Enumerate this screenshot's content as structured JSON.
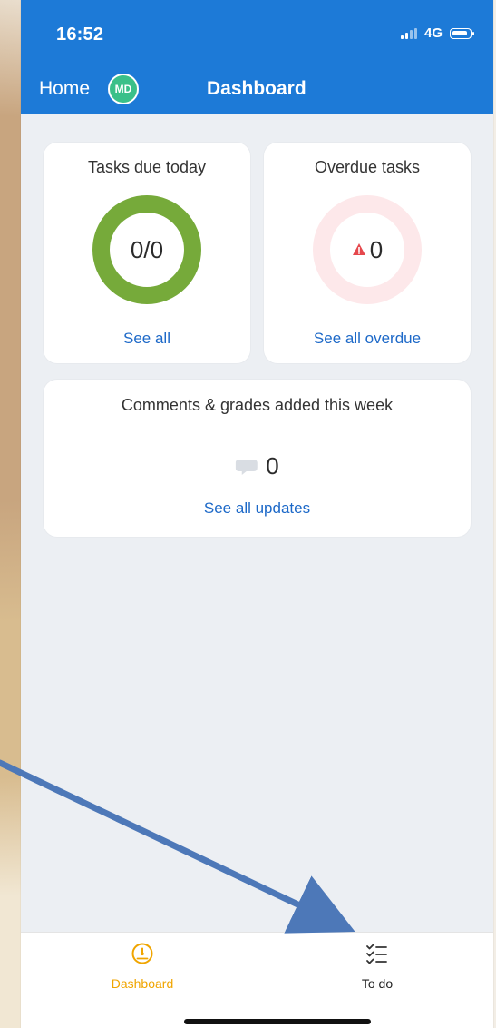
{
  "status_bar": {
    "time": "16:52",
    "network": "4G"
  },
  "header": {
    "home_label": "Home",
    "avatar_initials": "MD",
    "title": "Dashboard"
  },
  "cards": {
    "tasks_due_today": {
      "title": "Tasks due today",
      "value": "0/0",
      "link": "See all"
    },
    "overdue_tasks": {
      "title": "Overdue tasks",
      "value": "0",
      "link": "See all overdue"
    },
    "comments_grades": {
      "title": "Comments & grades added this week",
      "value": "0",
      "link": "See all updates"
    }
  },
  "bottom_nav": {
    "dashboard_label": "Dashboard",
    "todo_label": "To do"
  },
  "icons": {
    "signal": "signal-icon",
    "battery": "battery-icon",
    "warning": "warning-icon",
    "comment": "comment-icon",
    "dashboard": "gauge-icon",
    "todo": "checklist-icon"
  },
  "colors": {
    "header_blue": "#1d7ad7",
    "tasks_ring_green": "#76aa3a",
    "overdue_ring_pink": "#fde8ea",
    "link_blue": "#1d69c8",
    "dashboard_orange": "#f0a500",
    "annotation_arrow": "#4d78b8"
  }
}
